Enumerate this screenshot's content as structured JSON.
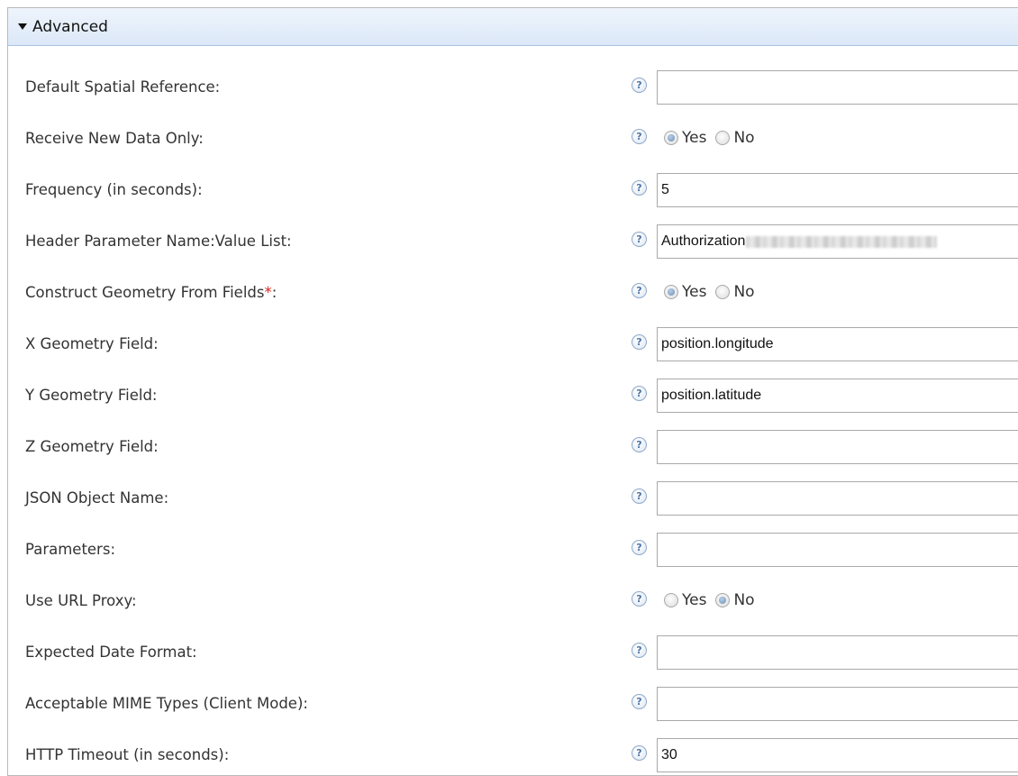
{
  "section": {
    "title": "Advanced",
    "collapse_icon": "caret-down-icon"
  },
  "help_glyph": "?",
  "fields": {
    "default_spatial_reference": {
      "label": "Default Spatial Reference:",
      "value": ""
    },
    "receive_new_data_only": {
      "label": "Receive New Data Only:",
      "options": [
        "Yes",
        "No"
      ],
      "selected": "Yes"
    },
    "frequency": {
      "label": "Frequency (in seconds):",
      "value": "5"
    },
    "header_parameter": {
      "label": "Header Parameter Name:Value List:",
      "value": "Authorization"
    },
    "construct_geometry": {
      "label": "Construct Geometry From Fields",
      "required_mark": "*",
      "suffix": ":",
      "options": [
        "Yes",
        "No"
      ],
      "selected": "Yes"
    },
    "x_geometry_field": {
      "label": "X Geometry Field:",
      "value": "position.longitude"
    },
    "y_geometry_field": {
      "label": "Y Geometry Field:",
      "value": "position.latitude"
    },
    "z_geometry_field": {
      "label": "Z Geometry Field:",
      "value": ""
    },
    "json_object_name": {
      "label": "JSON Object Name:",
      "value": ""
    },
    "parameters": {
      "label": "Parameters:",
      "value": ""
    },
    "use_url_proxy": {
      "label": "Use URL Proxy:",
      "options": [
        "Yes",
        "No"
      ],
      "selected": "No"
    },
    "expected_date_format": {
      "label": "Expected Date Format:",
      "value": ""
    },
    "acceptable_mime_types": {
      "label": "Acceptable MIME Types (Client Mode):",
      "value": ""
    },
    "http_timeout": {
      "label": "HTTP Timeout (in seconds):",
      "value": "30"
    }
  },
  "colors": {
    "required": "#d9261c",
    "header_bg": "#dce8f8",
    "radio_selected": "#6c8fb6"
  }
}
